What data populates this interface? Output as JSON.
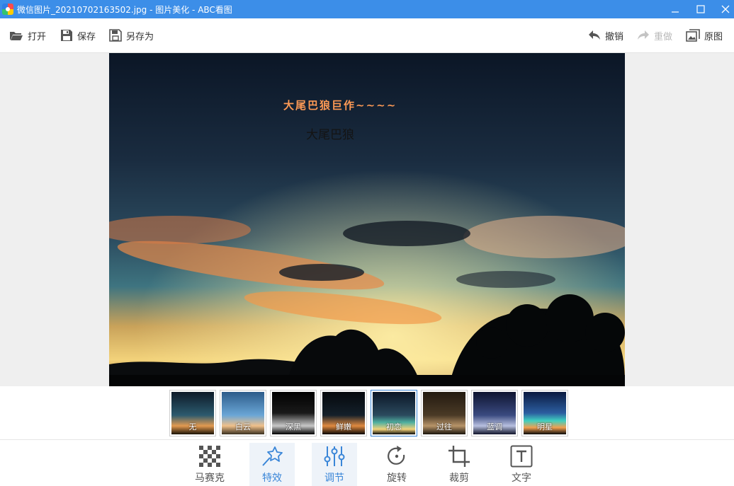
{
  "window": {
    "title": "微信图片_20210702163502.jpg - 图片美化 - ABC看图",
    "controls": [
      "minimize-icon",
      "maximize-icon",
      "close-icon"
    ]
  },
  "toolbar": {
    "open_label": "打开",
    "save_label": "保存",
    "save_as_label": "另存为",
    "undo_label": "撤销",
    "redo_label": "重做",
    "original_label": "原图",
    "redo_enabled": false
  },
  "image": {
    "watermark_text": "大尾巴狼巨作~~~~",
    "caption_text": "大尾巴狼"
  },
  "filters": {
    "items": [
      {
        "label": "无",
        "active": false
      },
      {
        "label": "白云",
        "active": false
      },
      {
        "label": "深黑",
        "active": false
      },
      {
        "label": "鲜嫩",
        "active": false
      },
      {
        "label": "初恋",
        "active": true
      },
      {
        "label": "过往",
        "active": false
      },
      {
        "label": "蓝调",
        "active": false
      },
      {
        "label": "明星",
        "active": false
      }
    ]
  },
  "tools": {
    "mosaic_label": "马赛克",
    "effects_label": "特效",
    "adjust_label": "调节",
    "rotate_label": "旋转",
    "crop_label": "裁剪",
    "text_label": "文字",
    "active": [
      "effects",
      "adjust"
    ]
  },
  "colors": {
    "titlebar": "#3c8ee8",
    "accent": "#3a86d8",
    "canvas_bg": "#efefef"
  }
}
